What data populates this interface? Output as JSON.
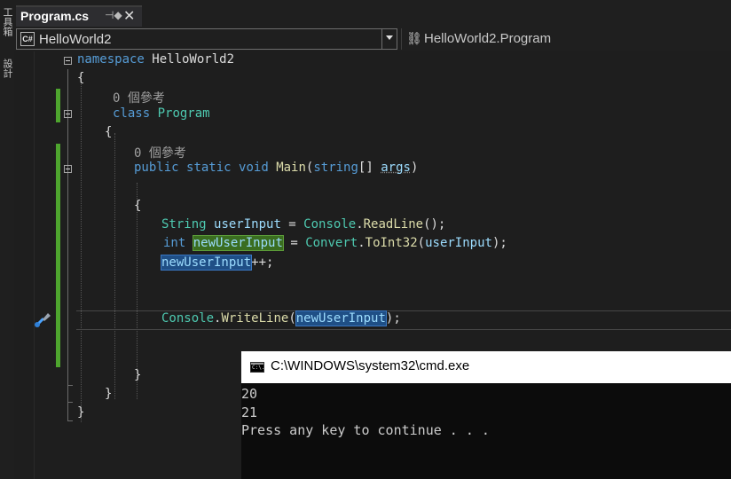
{
  "toolbox_strip": {
    "labels": [
      "工具箱",
      "設計"
    ]
  },
  "tab": {
    "title": "Program.cs",
    "pin_icon": "pin-icon",
    "close_icon": "close-icon"
  },
  "nav": {
    "project_badge": "C#",
    "project": "HelloWorld2",
    "class_icon": "class-icon",
    "class_name": "HelloWorld2.Program"
  },
  "code": {
    "line1": {
      "kw": "namespace",
      "name": " HelloWorld2"
    },
    "brace_open": "{",
    "brace_close": "}",
    "ref_program": "0 個參考",
    "line_class": {
      "kw": "class",
      "name": "Program"
    },
    "ref_main": "0 個參考",
    "line_main": {
      "public": "public",
      "static": "static",
      "void": "void",
      "main": "Main",
      "p1": "(",
      "string": "string",
      "p2": "[] ",
      "args": "args",
      "p3": ")"
    },
    "line_read": {
      "type": "String",
      "var": "userInput",
      "eq": " = ",
      "cls": "Console",
      "dot": ".",
      "fn": "ReadLine",
      "end": "();"
    },
    "line_conv": {
      "kw": "int",
      "var": "newUserInput",
      "eq": " = ",
      "cls": "Convert",
      "dot": ".",
      "fn": "ToInt32",
      "open": "(",
      "arg": "userInput",
      "end": ");"
    },
    "line_inc": {
      "var": "newUserInput",
      "op": "++;"
    },
    "line_write": {
      "cls": "Console",
      "dot": ".",
      "fn": "WriteLine",
      "open": "(",
      "arg": "newUserInput",
      "end": ");"
    }
  },
  "console": {
    "title": "C:\\WINDOWS\\system32\\cmd.exe",
    "icon_text": "C:\\.",
    "lines": [
      "20",
      "21",
      "Press any key to continue . . ."
    ]
  },
  "colors": {
    "keyword": "#569cd6",
    "type": "#4ec9b0",
    "method": "#dcdcaa",
    "identifier": "#9cdcfe",
    "change_bar": "#4ea52e"
  }
}
